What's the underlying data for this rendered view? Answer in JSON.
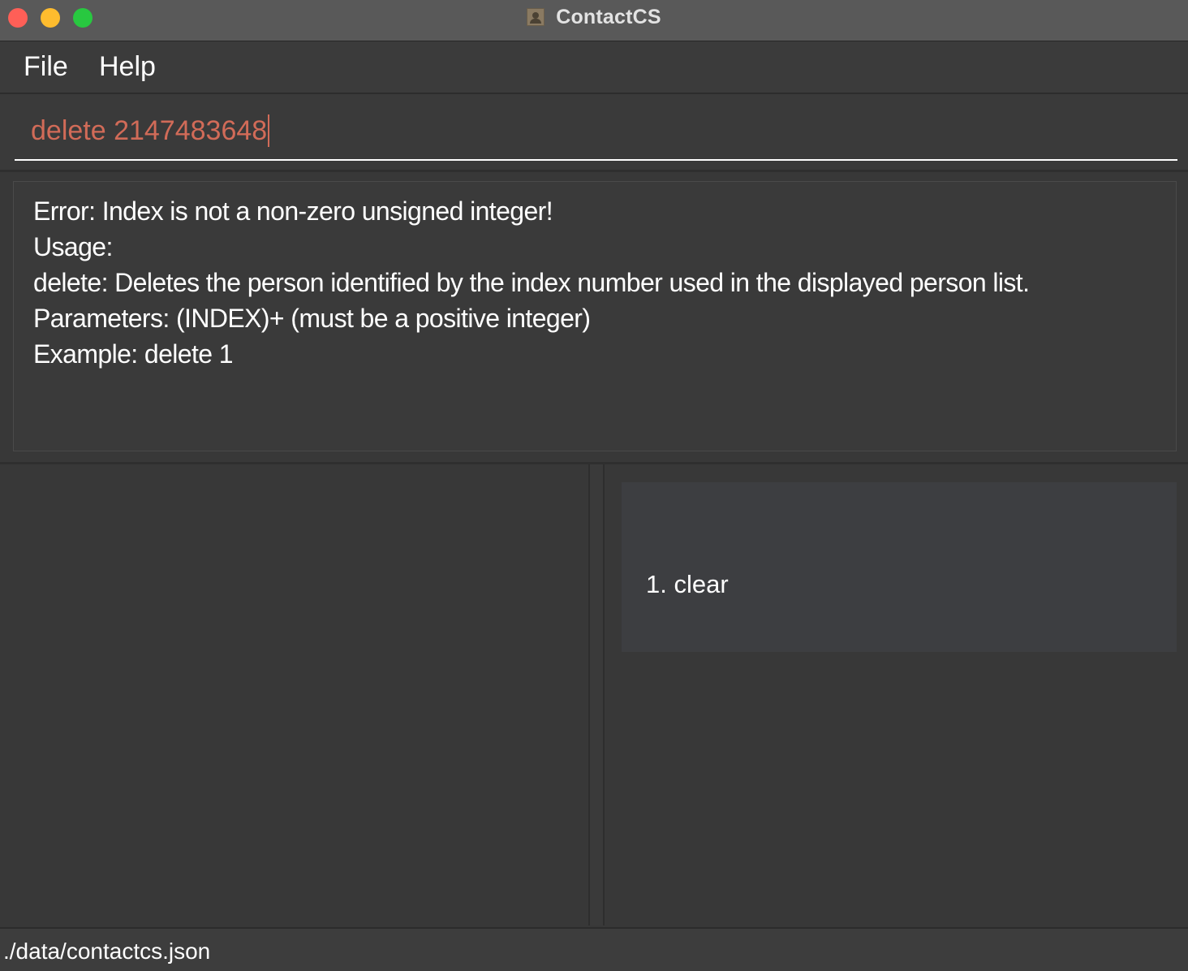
{
  "window": {
    "title": "ContactCS"
  },
  "menu": {
    "file": "File",
    "help": "Help"
  },
  "command": {
    "value": "delete 2147483648"
  },
  "result": {
    "lines": [
      "Error: Index is not a non-zero unsigned integer!",
      "Usage:",
      "delete: Deletes the person identified by the index number used in the displayed person list.",
      "Parameters: (INDEX)+ (must be a positive integer)",
      "Example: delete 1"
    ]
  },
  "history": {
    "items": [
      "1. clear"
    ]
  },
  "status": {
    "file_path": "./data/contactcs.json"
  },
  "colors": {
    "command_text": "#d16b58",
    "close": "#ff5f57",
    "minimize": "#febc2e",
    "maximize": "#28c840"
  }
}
